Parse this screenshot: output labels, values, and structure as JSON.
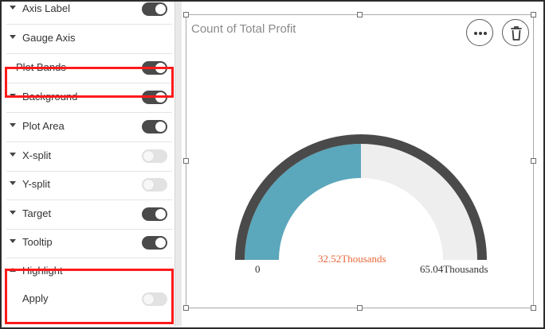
{
  "panel": {
    "rows": [
      {
        "label": "Axis Label",
        "arrow": "down",
        "toggle": "on"
      },
      {
        "label": "Gauge Axis",
        "arrow": "down",
        "toggle": null
      },
      {
        "label": "Plot Bands",
        "arrow": null,
        "toggle": "on"
      },
      {
        "label": "Background",
        "arrow": "down",
        "toggle": "on"
      },
      {
        "label": "Plot Area",
        "arrow": "down",
        "toggle": "on"
      },
      {
        "label": "X-split",
        "arrow": "down",
        "toggle": "off"
      },
      {
        "label": "Y-split",
        "arrow": "down",
        "toggle": "off"
      },
      {
        "label": "Target",
        "arrow": "down",
        "toggle": "on"
      },
      {
        "label": "Tooltip",
        "arrow": "down",
        "toggle": "on"
      },
      {
        "label": "Highlight",
        "arrow": "up",
        "toggle": null
      },
      {
        "label": "Apply",
        "arrow": null,
        "toggle": "off"
      }
    ]
  },
  "widget": {
    "title": "Count of Total Profit",
    "more_icon": "ellipsis-icon",
    "delete_icon": "trash-icon"
  },
  "chart_data": {
    "type": "gauge",
    "title": "Count of Total Profit",
    "min": 0,
    "max": 65.04,
    "value": 32.52,
    "unit": "Thousands",
    "min_label": "0",
    "value_label": "32.52Thousands",
    "max_label": "65.04Thousands",
    "colors": {
      "fill": "#5ba7bb",
      "track": "#eeeeee",
      "band": "#4a4a4a",
      "value_label": "#e8683a",
      "axis_label": "#333333"
    }
  },
  "colors": {
    "highlight_box": "#ff1a1a",
    "toggle_on": "#4a4a4a",
    "toggle_off": "#e2e2e2"
  }
}
